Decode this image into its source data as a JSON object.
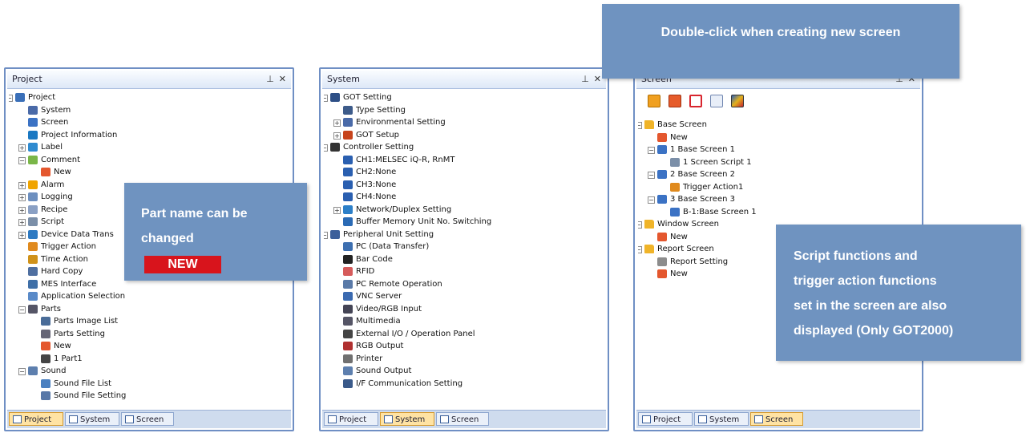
{
  "colors": {
    "callout": "#6f93c0",
    "badge": "#d8141c",
    "active_tab": "#ffe3a3",
    "panel_border": "#6f8fc4"
  },
  "bottom_tabs": [
    "Project",
    "System",
    "Screen"
  ],
  "panels": {
    "project": {
      "title": "Project",
      "controls": [
        "pin-icon",
        "close-icon"
      ],
      "items": [
        {
          "label": "Project",
          "expander": "minus",
          "icon": "project-icon"
        },
        {
          "label": "System",
          "icon": "system-icon"
        },
        {
          "label": "Screen",
          "icon": "screen-icon"
        },
        {
          "label": "Project Information",
          "icon": "info-icon"
        },
        {
          "label": "Label",
          "expander": "plus",
          "icon": "label-icon"
        },
        {
          "label": "Comment",
          "expander": "minus",
          "icon": "comment-icon"
        },
        {
          "label": "New",
          "icon": "new-icon"
        },
        {
          "label": "Alarm",
          "expander": "plus",
          "icon": "alarm-icon"
        },
        {
          "label": "Logging",
          "expander": "plus",
          "icon": "logging-icon"
        },
        {
          "label": "Recipe",
          "expander": "plus",
          "icon": "recipe-icon"
        },
        {
          "label": "Script",
          "expander": "plus",
          "icon": "script-icon"
        },
        {
          "label": "Device Data Trans",
          "expander": "plus",
          "icon": "device-data-icon"
        },
        {
          "label": "Trigger Action",
          "icon": "trigger-action-icon"
        },
        {
          "label": "Time Action",
          "icon": "time-action-icon"
        },
        {
          "label": "Hard Copy",
          "icon": "hard-copy-icon"
        },
        {
          "label": "MES Interface",
          "icon": "mes-icon"
        },
        {
          "label": "Application Selection",
          "icon": "application-icon"
        },
        {
          "label": "Parts",
          "expander": "minus",
          "icon": "parts-icon"
        },
        {
          "label": "Parts Image List",
          "icon": "parts-image-icon"
        },
        {
          "label": "Parts Setting",
          "icon": "parts-setting-icon"
        },
        {
          "label": "New",
          "icon": "new-icon"
        },
        {
          "label": "1 Part1",
          "icon": "part-icon"
        },
        {
          "label": "Sound",
          "expander": "minus",
          "icon": "sound-icon"
        },
        {
          "label": "Sound File List",
          "icon": "sound-file-icon"
        },
        {
          "label": "Sound File Setting",
          "icon": "sound-setting-icon"
        }
      ]
    },
    "system": {
      "title": "System",
      "controls": [
        "pin-icon",
        "close-icon"
      ],
      "items": [
        {
          "label": "GOT Setting",
          "expander": "minus",
          "icon": "got-icon"
        },
        {
          "label": "Type Setting",
          "icon": "type-icon"
        },
        {
          "label": "Environmental Setting",
          "expander": "plus",
          "icon": "env-icon"
        },
        {
          "label": "GOT Setup",
          "expander": "plus",
          "icon": "got-setup-icon"
        },
        {
          "label": "Controller Setting",
          "expander": "minus",
          "icon": "controller-icon"
        },
        {
          "label": "CH1:MELSEC iQ-R, RnMT",
          "icon": "channel-icon"
        },
        {
          "label": "CH2:None",
          "icon": "channel-icon"
        },
        {
          "label": "CH3:None",
          "icon": "channel-icon"
        },
        {
          "label": "CH4:None",
          "icon": "channel-icon"
        },
        {
          "label": "Network/Duplex Setting",
          "expander": "plus",
          "icon": "network-icon"
        },
        {
          "label": "Buffer Memory Unit No. Switching",
          "icon": "buffer-icon"
        },
        {
          "label": "Peripheral Unit Setting",
          "expander": "minus",
          "icon": "peripheral-icon"
        },
        {
          "label": "PC (Data Transfer)",
          "icon": "pc-icon"
        },
        {
          "label": "Bar Code",
          "icon": "barcode-icon"
        },
        {
          "label": "RFID",
          "icon": "rfid-icon"
        },
        {
          "label": "PC Remote Operation",
          "icon": "remote-icon"
        },
        {
          "label": "VNC Server",
          "icon": "vnc-icon"
        },
        {
          "label": "Video/RGB Input",
          "icon": "video-icon"
        },
        {
          "label": "Multimedia",
          "icon": "multimedia-icon"
        },
        {
          "label": "External I/O / Operation Panel",
          "icon": "external-io-icon"
        },
        {
          "label": "RGB Output",
          "icon": "rgb-icon"
        },
        {
          "label": "Printer",
          "icon": "printer-icon"
        },
        {
          "label": "Sound Output",
          "icon": "sound-icon"
        },
        {
          "label": "I/F Communication Setting",
          "icon": "interface-icon"
        }
      ]
    },
    "screen": {
      "title": "Screen",
      "controls": [
        "pin-icon",
        "close-icon"
      ],
      "toolbar": [
        "open-folder-icon",
        "new-screen-icon",
        "screen-list-icon",
        "copy-icon",
        "image-icon"
      ],
      "items": [
        {
          "label": "Base Screen",
          "expander": "minus",
          "icon": "folder-icon"
        },
        {
          "label": "New",
          "icon": "new-icon"
        },
        {
          "label": "1 Base Screen 1",
          "expander": "minus",
          "icon": "screen-icon"
        },
        {
          "label": "1 Screen Script 1",
          "icon": "script-icon"
        },
        {
          "label": "2 Base Screen 2",
          "expander": "minus",
          "icon": "screen-icon"
        },
        {
          "label": "Trigger Action1",
          "icon": "trigger-action-icon"
        },
        {
          "label": "3 Base Screen 3",
          "expander": "minus",
          "icon": "screen-icon"
        },
        {
          "label": "B-1:Base Screen 1",
          "icon": "screen-icon"
        },
        {
          "label": "Window Screen",
          "expander": "minus",
          "icon": "folder-icon"
        },
        {
          "label": "New",
          "icon": "new-icon"
        },
        {
          "label": "Report Screen",
          "expander": "minus",
          "icon": "folder-icon"
        },
        {
          "label": "Report Setting",
          "icon": "report-icon"
        },
        {
          "label": "New",
          "icon": "new-icon"
        }
      ]
    }
  },
  "callouts": {
    "part_name": {
      "line1": "Part name can be",
      "line2": "changed",
      "badge": "NEW"
    },
    "double_click": {
      "text": "Double-click when creating new screen"
    },
    "script": {
      "lines": [
        "Script functions and",
        "trigger action functions",
        "set in the screen are also",
        "displayed (Only GOT2000)"
      ]
    }
  }
}
